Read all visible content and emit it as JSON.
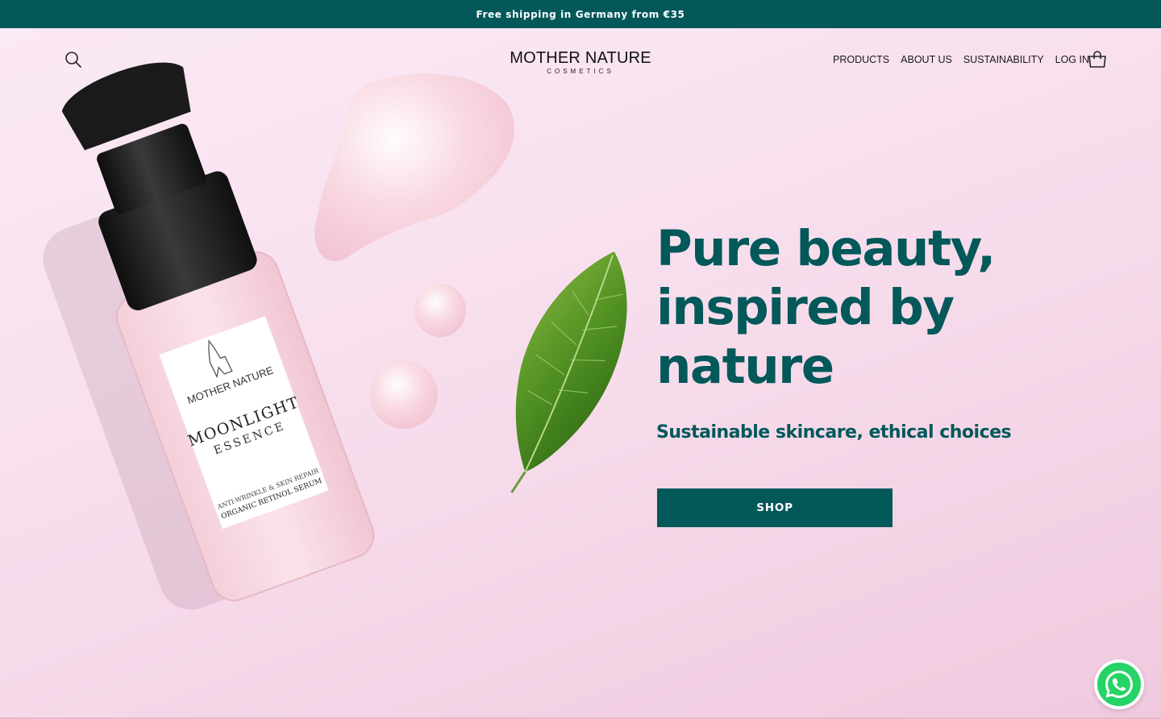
{
  "announcement": {
    "text": "Free shipping in Germany from €35"
  },
  "header": {
    "logo": {
      "name": "MOTHER NATURE",
      "tagline": "COSMETICS"
    },
    "nav": [
      {
        "label": "PRODUCTS"
      },
      {
        "label": "ABOUT US"
      },
      {
        "label": "SUSTAINABILITY"
      },
      {
        "label": "LOG IN"
      }
    ],
    "icons": {
      "search": "search-icon",
      "cart": "shopping-bag-icon"
    }
  },
  "hero": {
    "headline": "Pure beauty, inspired by nature",
    "subheadline": "Sustainable skincare, ethical choices",
    "cta_label": "SHOP",
    "product": {
      "brand": "MOTHER NATURE",
      "name_line1": "MOONLIGHT",
      "name_line2": "ESSENCE",
      "desc_line1": "ANTI-WRINKLE & SKIN REPAIR",
      "desc_line2": "ORGANIC RETINOL SERUM"
    }
  },
  "floating": {
    "whatsapp_icon": "whatsapp-icon"
  },
  "colors": {
    "brand": "#03585a",
    "hero_background": "#f7dcea",
    "text_dark": "#1a1a1a"
  }
}
